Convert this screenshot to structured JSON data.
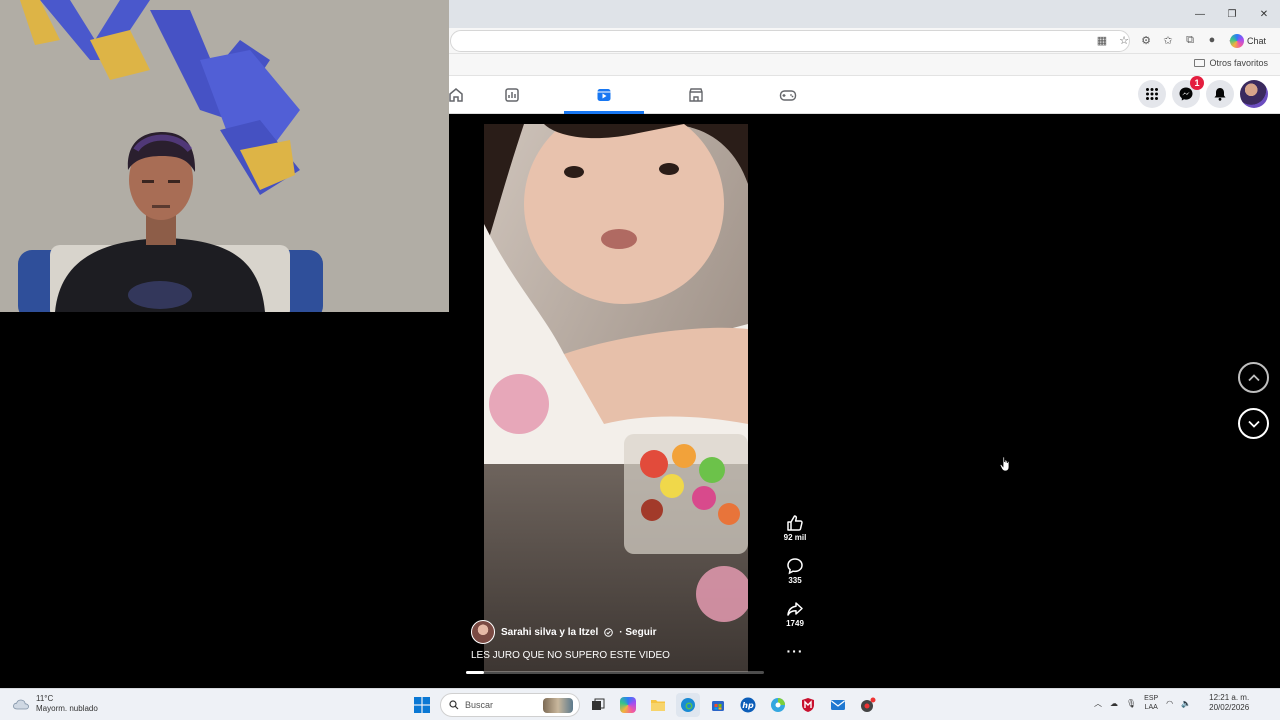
{
  "browser": {
    "chat_label": "Chat",
    "favorites_label": "Otros favoritos",
    "window_controls": [
      "minimize-icon",
      "restore-icon",
      "close-icon"
    ]
  },
  "facebook": {
    "nav": [
      "home-icon",
      "dashboard-icon",
      "video-icon",
      "marketplace-icon",
      "gaming-icon"
    ],
    "active_nav": "video-icon",
    "messenger_badge": "1",
    "accent_color": "#1877f2"
  },
  "reel": {
    "author": "Sarahi silva y la Itzel",
    "follow_label": "· Seguir",
    "caption": "LES JURO QUE NO SUPERO ESTE VIDEO",
    "likes": "92 mil",
    "comments": "335",
    "shares": "1749",
    "progress_fraction": 0.06
  },
  "taskbar": {
    "weather_temp": "11°C",
    "weather_desc": "Mayorm. nublado",
    "search_placeholder": "Buscar",
    "lang_1": "ESP",
    "lang_2": "LAA",
    "time": "12:21 a. m.",
    "date": "20/02/2026"
  }
}
